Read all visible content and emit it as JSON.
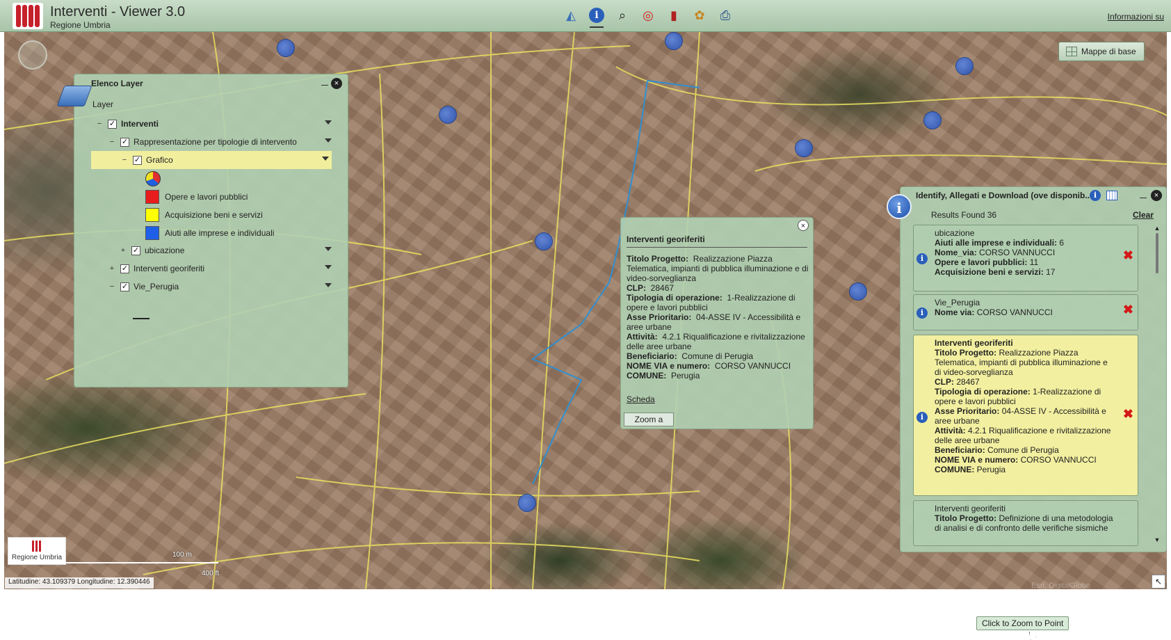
{
  "header": {
    "title": "Interventi - Viewer 3.0",
    "subtitle": "Regione Umbria",
    "info_link": "Informazioni su",
    "toolbar": [
      {
        "name": "layers-tool-button",
        "icon": "layers-icon",
        "glyph": "◭"
      },
      {
        "name": "identify-tool-button",
        "icon": "info-icon",
        "glyph": "i"
      },
      {
        "name": "search-tool-button",
        "icon": "binoculars-icon",
        "glyph": "⌕"
      },
      {
        "name": "target-tool-button",
        "icon": "target-icon",
        "glyph": "◎"
      },
      {
        "name": "bookmark-tool-button",
        "icon": "book-icon",
        "glyph": "▮"
      },
      {
        "name": "styles-tool-button",
        "icon": "palette-icon",
        "glyph": "✿"
      },
      {
        "name": "print-tool-button",
        "icon": "printer-icon",
        "glyph": "⎙"
      }
    ]
  },
  "map": {
    "basemap_button": "Mappe di base",
    "brand_label": "Regione Umbria",
    "scale_m": "100 m",
    "scale_ft": "400 ft",
    "coordinates": "Latitudine: 43.109379     Longitudine: 12.390446",
    "copyright": "Esri, DigitalGlobe"
  },
  "layer_panel": {
    "title": "Elenco Layer",
    "root": "Layer",
    "tree": [
      {
        "label": "Interventi",
        "bold": true,
        "toggle": "−"
      },
      {
        "label": "Rappresentazione per tipologie di intervento",
        "toggle": "−"
      },
      {
        "label": "Grafico",
        "toggle": "−"
      },
      {
        "label": "ubicazione",
        "toggle": "+"
      },
      {
        "label": "Interventi georiferiti",
        "toggle": "+"
      },
      {
        "label": "Vie_Perugia",
        "toggle": "−"
      }
    ],
    "legend": [
      {
        "label": "Opere e lavori pubblici",
        "color": "#e81c1c"
      },
      {
        "label": "Acquisizione beni e servizi",
        "color": "#ffff00"
      },
      {
        "label": "Aiuti alle imprese e individuali",
        "color": "#1f5fe8"
      }
    ]
  },
  "popup": {
    "title": "Interventi georiferiti",
    "fields": [
      {
        "label": "Titolo Progetto:",
        "value": "Realizzazione Piazza Telematica, impianti di pubblica illuminazione e di video-sorveglianza"
      },
      {
        "label": "CLP:",
        "value": "28467"
      },
      {
        "label": "Tipologia di operazione:",
        "value": "1-Realizzazione di opere e lavori pubblici"
      },
      {
        "label": "Asse Prioritario:",
        "value": "04-ASSE IV - Accessibilità e aree urbane"
      },
      {
        "label": "Attività:",
        "value": "4.2.1 Riqualificazione e rivitalizzazione delle aree urbane"
      },
      {
        "label": "Beneficiario:",
        "value": "Comune di Perugia"
      },
      {
        "label": "NOME VIA e numero:",
        "value": "CORSO VANNUCCI"
      },
      {
        "label": "COMUNE:",
        "value": "Perugia"
      }
    ],
    "link": "Scheda",
    "button": "Zoom a"
  },
  "identify": {
    "title": "Identify, Allegati e Download (ove disponib...",
    "results": "Results Found 36",
    "clear": "Clear",
    "tooltip": "Click to Zoom to Point",
    "cards": [
      {
        "title": "ubicazione",
        "lines": [
          {
            "label": "Aiuti alle imprese e individuali:",
            "value": "6"
          },
          {
            "label": "Nome_via:",
            "value": "CORSO VANNUCCI"
          },
          {
            "label": "Opere e lavori pubblici:",
            "value": "11"
          },
          {
            "label": "Acquisizione beni e servizi:",
            "value": "17"
          }
        ]
      },
      {
        "title": "Vie_Perugia",
        "lines": [
          {
            "label": "Nome via:",
            "value": "CORSO VANNUCCI"
          }
        ]
      },
      {
        "title": "Interventi georiferiti",
        "lines": [
          {
            "label": "Titolo Progetto:",
            "value": "Realizzazione Piazza Telematica, impianti di pubblica illuminazione e di video-sorveglianza"
          },
          {
            "label": "CLP:",
            "value": "28467"
          },
          {
            "label": "Tipologia di operazione:",
            "value": "1-Realizzazione di opere e lavori pubblici"
          },
          {
            "label": "Asse Prioritario:",
            "value": "04-ASSE IV - Accessibilità e aree urbane"
          },
          {
            "label": "Attività:",
            "value": "4.2.1 Riqualificazione e rivitalizzazione delle aree urbane"
          },
          {
            "label": "Beneficiario:",
            "value": "Comune di Perugia"
          },
          {
            "label": "NOME VIA e numero:",
            "value": "CORSO VANNUCCI"
          },
          {
            "label": "COMUNE:",
            "value": "Perugia"
          }
        ]
      },
      {
        "title": "Interventi georiferiti",
        "lines": [
          {
            "label": "Titolo Progetto:",
            "value": "Definizione di una metodologia di analisi e di confronto delle verifiche sismiche"
          }
        ]
      }
    ]
  }
}
